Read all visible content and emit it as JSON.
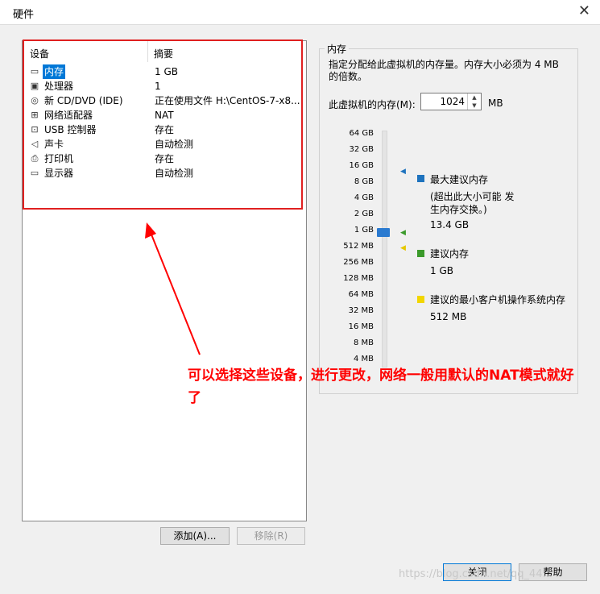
{
  "window": {
    "title": "硬件",
    "close_icon": "close-icon"
  },
  "device_list": {
    "col_device": "设备",
    "col_summary": "摘要",
    "rows": [
      {
        "name": "内存",
        "summary": "1 GB",
        "icon": "memory-icon",
        "selected": true
      },
      {
        "name": "处理器",
        "summary": "1",
        "icon": "cpu-icon"
      },
      {
        "name": "新 CD/DVD (IDE)",
        "summary": "正在使用文件 H:\\CentOS-7-x8...",
        "icon": "cd-icon"
      },
      {
        "name": "网络适配器",
        "summary": "NAT",
        "icon": "network-icon"
      },
      {
        "name": "USB 控制器",
        "summary": "存在",
        "icon": "usb-icon"
      },
      {
        "name": "声卡",
        "summary": "自动检测",
        "icon": "speaker-icon"
      },
      {
        "name": "打印机",
        "summary": "存在",
        "icon": "printer-icon"
      },
      {
        "name": "显示器",
        "summary": "自动检测",
        "icon": "monitor-icon"
      }
    ]
  },
  "buttons": {
    "add": "添加(A)...",
    "remove": "移除(R)",
    "close": "关闭",
    "help": "帮助"
  },
  "memory": {
    "group_title": "内存",
    "description": "指定分配给此虚拟机的内存量。内存大小必须为 4 MB 的倍数。",
    "field_label": "此虚拟机的内存(M):",
    "value": "1024",
    "unit": "MB",
    "scale": [
      "64 GB",
      "32 GB",
      "16 GB",
      "8 GB",
      "4 GB",
      "2 GB",
      "1 GB",
      "512 MB",
      "256 MB",
      "128 MB",
      "64 MB",
      "32 MB",
      "16 MB",
      "8 MB",
      "4 MB"
    ],
    "legend": {
      "max_title": "最大建议内存",
      "max_note": "(超出此大小可能 发生内存交换。)",
      "max_value": "13.4 GB",
      "rec_title": "建议内存",
      "rec_value": "1 GB",
      "min_title": "建议的最小客户机操作系统内存",
      "min_value": "512 MB"
    },
    "colors": {
      "max": "#1e73be",
      "rec": "#3b9a2b",
      "min": "#f2d600"
    }
  },
  "annotation": {
    "text": "可以选择这些设备，进行更改，网络一般用默认的NAT模式就好了",
    "color": "#ff0000"
  },
  "watermark": "https://blog.csdn.net/qq_44..."
}
